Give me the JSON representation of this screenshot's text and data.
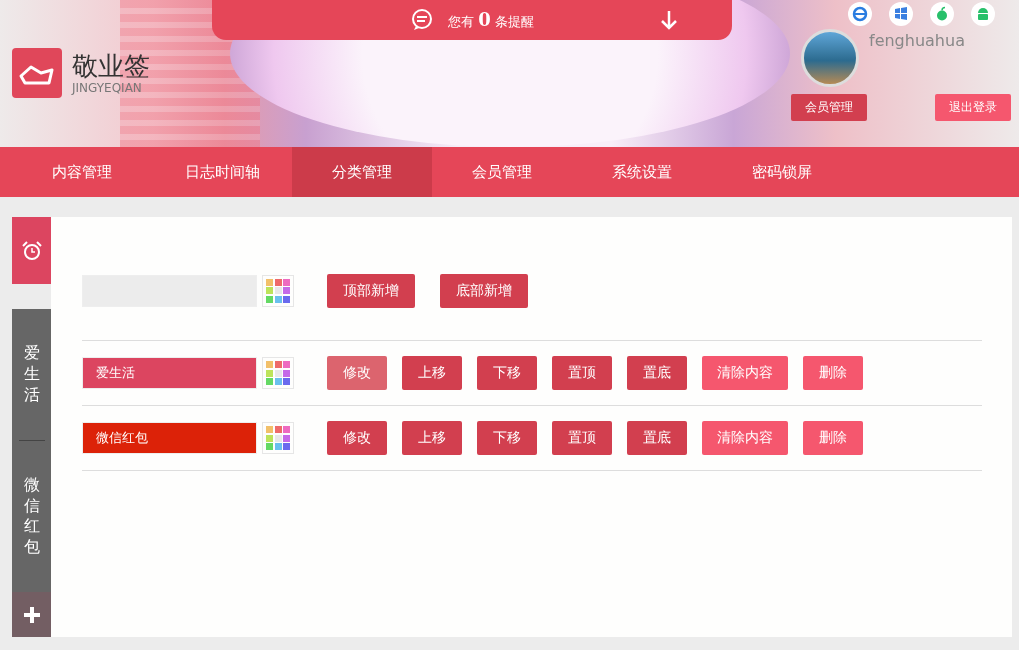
{
  "header": {
    "logo_title": "敬业签",
    "logo_subtitle": "JINGYEQIAN",
    "reminder": {
      "prefix": "您有",
      "count": "0",
      "suffix": "条提醒"
    },
    "username": "fenghuahua",
    "buttons": [
      {
        "label": "会员管理",
        "kind": "dark"
      },
      {
        "label": "退出登录",
        "kind": "light"
      }
    ]
  },
  "nav": [
    {
      "label": "内容管理",
      "selected": false
    },
    {
      "label": "日志时间轴",
      "selected": false
    },
    {
      "label": "分类管理",
      "selected": true
    },
    {
      "label": "会员管理",
      "selected": false
    },
    {
      "label": "系统设置",
      "selected": false
    },
    {
      "label": "密码锁屏",
      "selected": false
    }
  ],
  "sidebar": {
    "categories": [
      {
        "label": "爱生活"
      },
      {
        "label": "微信红包"
      }
    ]
  },
  "new_category": {
    "buttons": [
      "顶部新增",
      "底部新增"
    ]
  },
  "categories": [
    {
      "name": "爱生活",
      "color": "#dc4560",
      "buttons": [
        {
          "label": "修改",
          "kind": "normal",
          "highlighted": true
        },
        {
          "label": "上移",
          "kind": "normal",
          "highlighted": false
        },
        {
          "label": "下移",
          "kind": "normal",
          "highlighted": false
        },
        {
          "label": "置顶",
          "kind": "normal",
          "highlighted": false
        },
        {
          "label": "置底",
          "kind": "normal",
          "highlighted": false
        },
        {
          "label": "清除内容",
          "kind": "danger",
          "highlighted": false
        },
        {
          "label": "删除",
          "kind": "danger",
          "highlighted": false
        }
      ]
    },
    {
      "name": "微信红包",
      "color": "#dc2208",
      "buttons": [
        {
          "label": "修改",
          "kind": "normal",
          "highlighted": false
        },
        {
          "label": "上移",
          "kind": "normal",
          "highlighted": false
        },
        {
          "label": "下移",
          "kind": "normal",
          "highlighted": false
        },
        {
          "label": "置顶",
          "kind": "normal",
          "highlighted": false
        },
        {
          "label": "置底",
          "kind": "normal",
          "highlighted": false
        },
        {
          "label": "清除内容",
          "kind": "danger",
          "highlighted": false
        },
        {
          "label": "删除",
          "kind": "danger",
          "highlighted": false
        }
      ]
    }
  ]
}
